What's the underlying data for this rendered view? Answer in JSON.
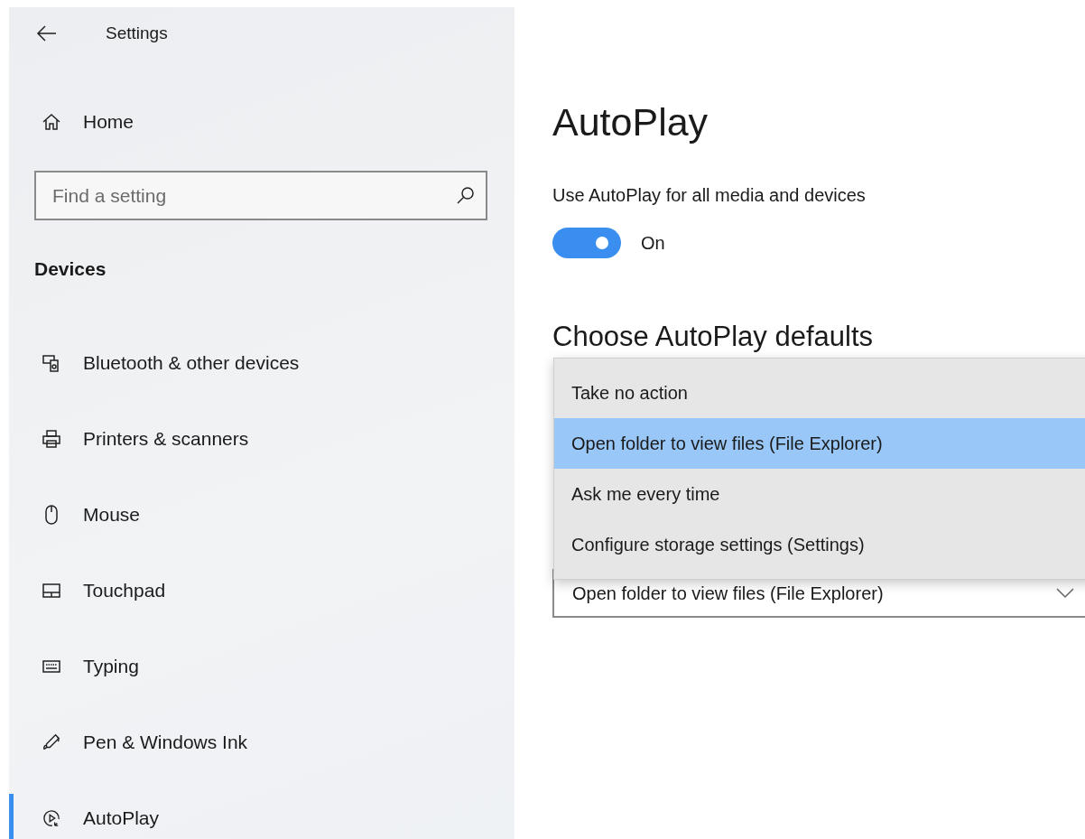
{
  "window": {
    "title": "Settings"
  },
  "sidebar": {
    "home": "Home",
    "search": {
      "placeholder": "Find a setting"
    },
    "section": "Devices",
    "items": [
      {
        "label": "Bluetooth & other devices",
        "selected": false
      },
      {
        "label": "Printers & scanners",
        "selected": false
      },
      {
        "label": "Mouse",
        "selected": false
      },
      {
        "label": "Touchpad",
        "selected": false
      },
      {
        "label": "Typing",
        "selected": false
      },
      {
        "label": "Pen & Windows Ink",
        "selected": false
      },
      {
        "label": "AutoPlay",
        "selected": true
      }
    ]
  },
  "main": {
    "title": "AutoPlay",
    "toggle": {
      "label": "Use AutoPlay for all media and devices",
      "on": true,
      "state_text": "On"
    },
    "defaults_heading": "Choose AutoPlay defaults",
    "dropdown": {
      "value": "Open folder to view files (File Explorer)",
      "expanded": true,
      "options": [
        {
          "label": "Take no action",
          "selected": false
        },
        {
          "label": "Open folder to view files (File Explorer)",
          "selected": true
        },
        {
          "label": "Ask me every time",
          "selected": false
        },
        {
          "label": "Configure storage settings (Settings)",
          "selected": false
        }
      ]
    }
  }
}
